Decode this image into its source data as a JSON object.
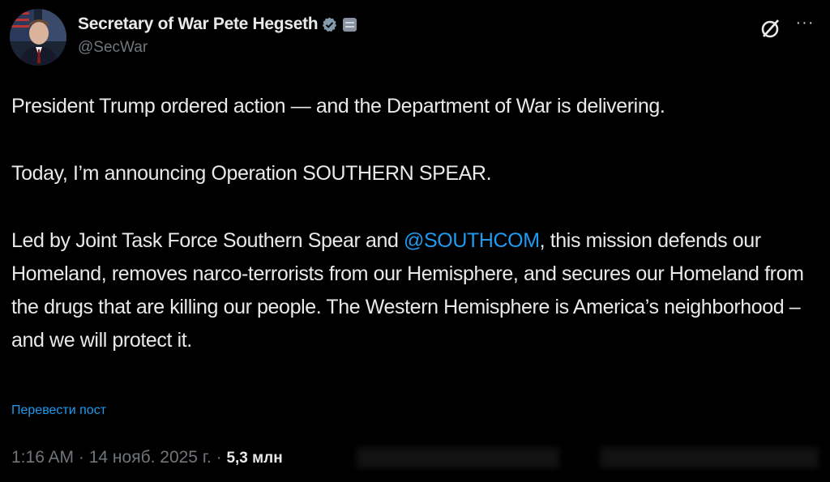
{
  "author": {
    "display_name": "Secretary of War Pete Hegseth",
    "handle": "@SecWar",
    "avatar": "avatar",
    "verified_icon": "verified-badge-icon",
    "affiliation_icon": "government-affiliation-icon"
  },
  "header_actions": {
    "grok_icon": "grok-icon",
    "more_icon": "more-options-icon"
  },
  "post": {
    "para1": "President Trump ordered action — and the Department of War is delivering.",
    "para2": "Today, I’m announcing Operation SOUTHERN SPEAR.",
    "para3_before": "Led by Joint Task Force Southern Spear and ",
    "para3_mention": "@SOUTHCOM",
    "para3_after": ", this mission defends our Homeland, removes narco-terrorists from our Hemisphere, and secures our Homeland from the drugs that are killing our people. The Western Hemisphere is America’s neighborhood – and we will protect it."
  },
  "translate_label": "Перевести пост",
  "meta": {
    "time": "1:16 AM",
    "separator": " · ",
    "date": "14 нояб. 2025 г.",
    "views": "5,3 млн"
  },
  "colors": {
    "background": "#000000",
    "text": "#e7e9ea",
    "secondary": "#71767b",
    "link": "#1d9bf0"
  }
}
